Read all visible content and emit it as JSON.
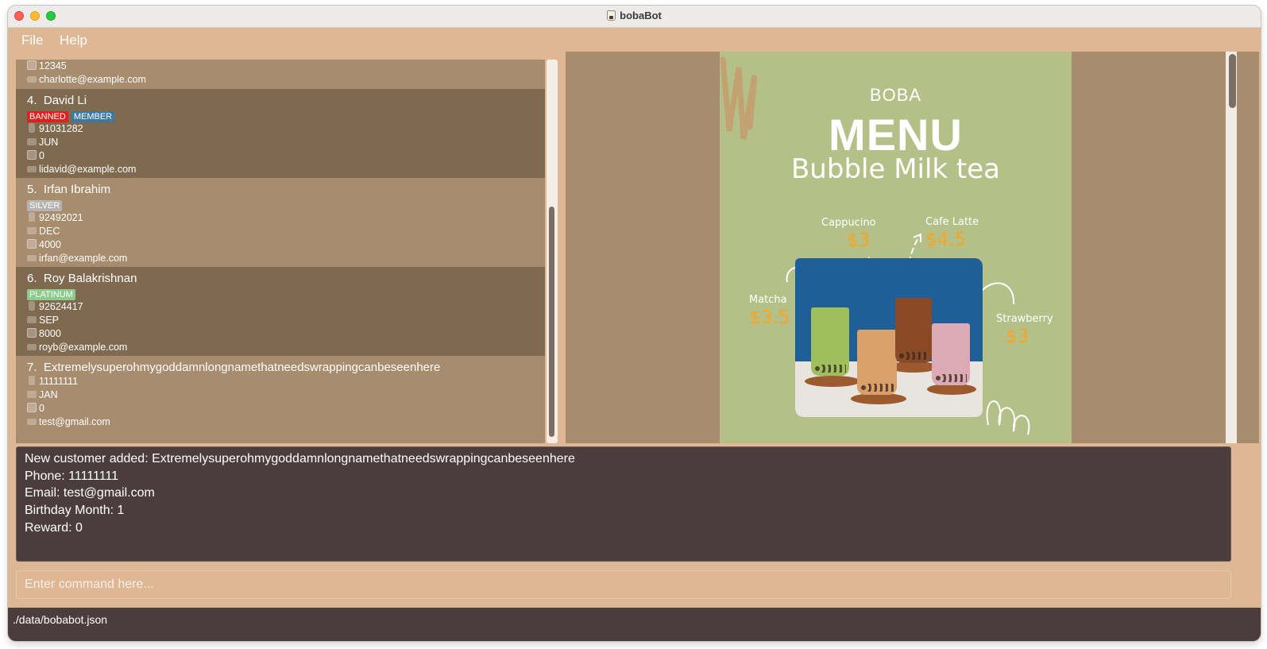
{
  "window": {
    "title": "bobaBot"
  },
  "menu": {
    "file": "File",
    "help": "Help"
  },
  "customers": {
    "partial": {
      "reward": "12345",
      "email": "charlotte@example.com"
    },
    "items": [
      {
        "index": "4.",
        "name": "David Li",
        "tags": [
          "BANNED",
          "MEMBER"
        ],
        "phone": "91031282",
        "birthday_month": "JUN",
        "reward": "0",
        "email": "lidavid@example.com"
      },
      {
        "index": "5.",
        "name": "Irfan Ibrahim",
        "tags": [
          "SILVER"
        ],
        "phone": "92492021",
        "birthday_month": "DEC",
        "reward": "4000",
        "email": "irfan@example.com"
      },
      {
        "index": "6.",
        "name": "Roy Balakrishnan",
        "tags": [
          "PLATINUM"
        ],
        "phone": "92624417",
        "birthday_month": "SEP",
        "reward": "8000",
        "email": "royb@example.com"
      },
      {
        "index": "7.",
        "name": "Extremelysuperohmygoddamnlongnamethatneedswrappingcanbeseenhere",
        "tags": [],
        "phone": "11111111",
        "birthday_month": "JAN",
        "reward": "0",
        "email": "test@gmail.com"
      }
    ]
  },
  "menu_image": {
    "brand": "BOBA",
    "title": "MENU",
    "subtitle": "Bubble Milk tea",
    "items": [
      {
        "name": "Cappucino",
        "price": "$3"
      },
      {
        "name": "Cafe Latte",
        "price": "$4.5"
      },
      {
        "name": "Matcha",
        "price": "$3.5"
      },
      {
        "name": "Strawberry",
        "price": "$3"
      }
    ]
  },
  "result": {
    "lines": [
      "New customer added: Extremelysuperohmygoddamnlongnamethatneedswrappingcanbeseenhere",
      "Phone: 11111111",
      "Email: test@gmail.com",
      "Birthday Month: 1",
      "Reward: 0"
    ]
  },
  "command": {
    "placeholder": "Enter command here...",
    "value": ""
  },
  "status": {
    "path": "./data/bobabot.json"
  },
  "colors": {
    "background": "#deb895",
    "card_light": "#a88c6e",
    "card_dark": "#806a4f",
    "result_bg": "#4b3d3e",
    "tag_banned": "#e0201d",
    "tag_member": "#3c78a0",
    "tag_silver": "#b6b4b0",
    "tag_platinum": "#8ccb8c",
    "price_accent": "#f6a623"
  }
}
